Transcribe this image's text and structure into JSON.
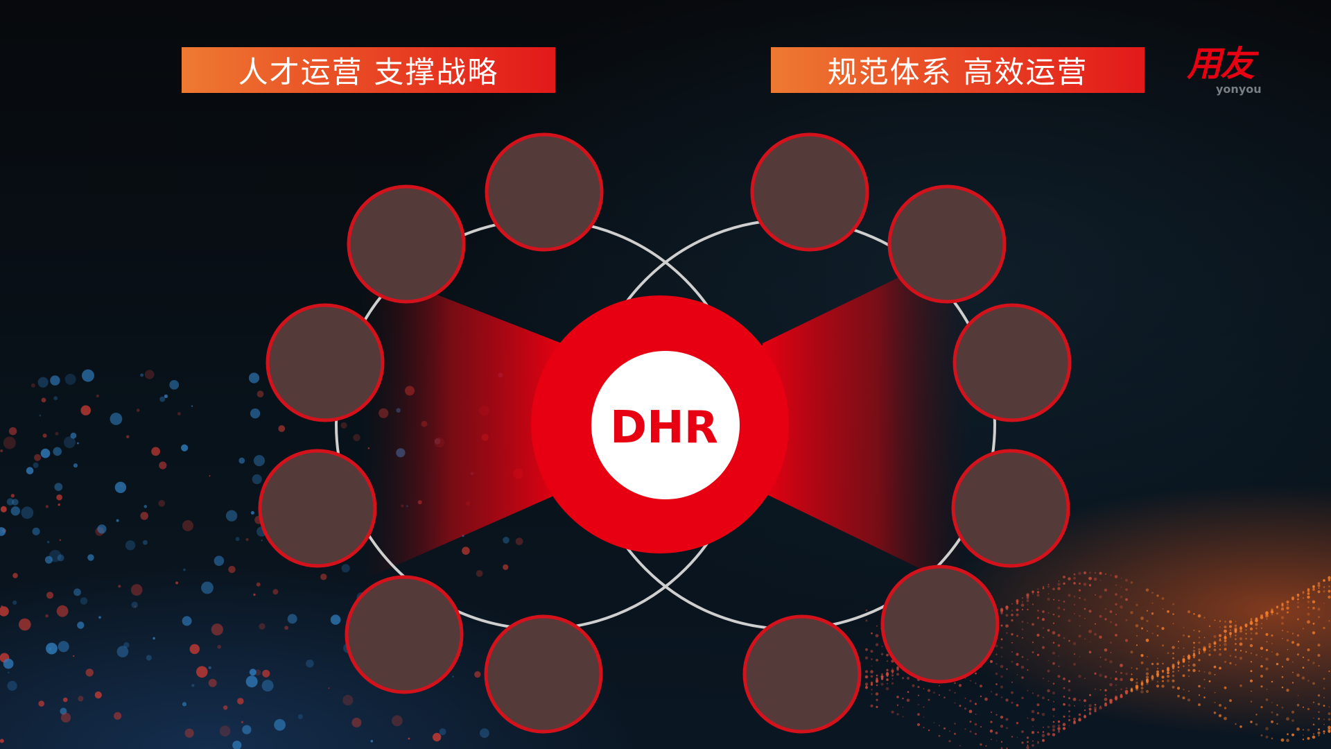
{
  "banners": {
    "left": "人才运营 支撑战略",
    "right": "规范体系 高效运营"
  },
  "logo": {
    "main": "用友",
    "sub": "yonyou"
  },
  "center": {
    "label": "DHR"
  },
  "colors": {
    "accent": "#e60012",
    "node_fill": "#553a3a",
    "node_border": "#d4121b",
    "ring": "#cfcfcf",
    "banner_start": "#ee7a32",
    "banner_end": "#e2191a"
  }
}
